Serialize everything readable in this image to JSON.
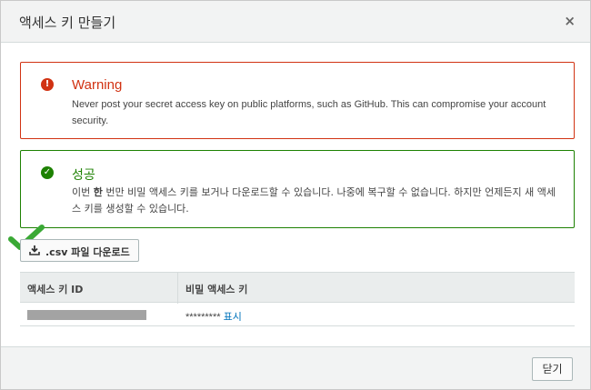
{
  "dialog": {
    "title": "액세스 키 만들기",
    "close_icon": "×"
  },
  "warning": {
    "icon": "!",
    "title": "Warning",
    "body": "Never post your secret access key on public platforms, such as GitHub. This can compromise your account security."
  },
  "success": {
    "icon": "✓",
    "title": "성공",
    "body_prefix": "이번 ",
    "body_bold": "한",
    "body_suffix": " 번만 비밀 액세스 키를 보거나 다운로드할 수 있습니다. 나중에 복구할 수 없습니다. 하지만 언제든지 새 액세스 키를 생성할 수 있습니다."
  },
  "download_button": {
    "label": ".csv 파일 다운로드",
    "icon": "download-icon"
  },
  "table": {
    "columns": [
      "액세스 키 ID",
      "비밀 액세스 키"
    ],
    "rows": [
      {
        "secret_masked": "*********",
        "show_label": "표시"
      }
    ]
  },
  "footer": {
    "close_label": "닫기"
  },
  "colors": {
    "warning": "#d13212",
    "success": "#1d8102",
    "link": "#0073bb"
  }
}
